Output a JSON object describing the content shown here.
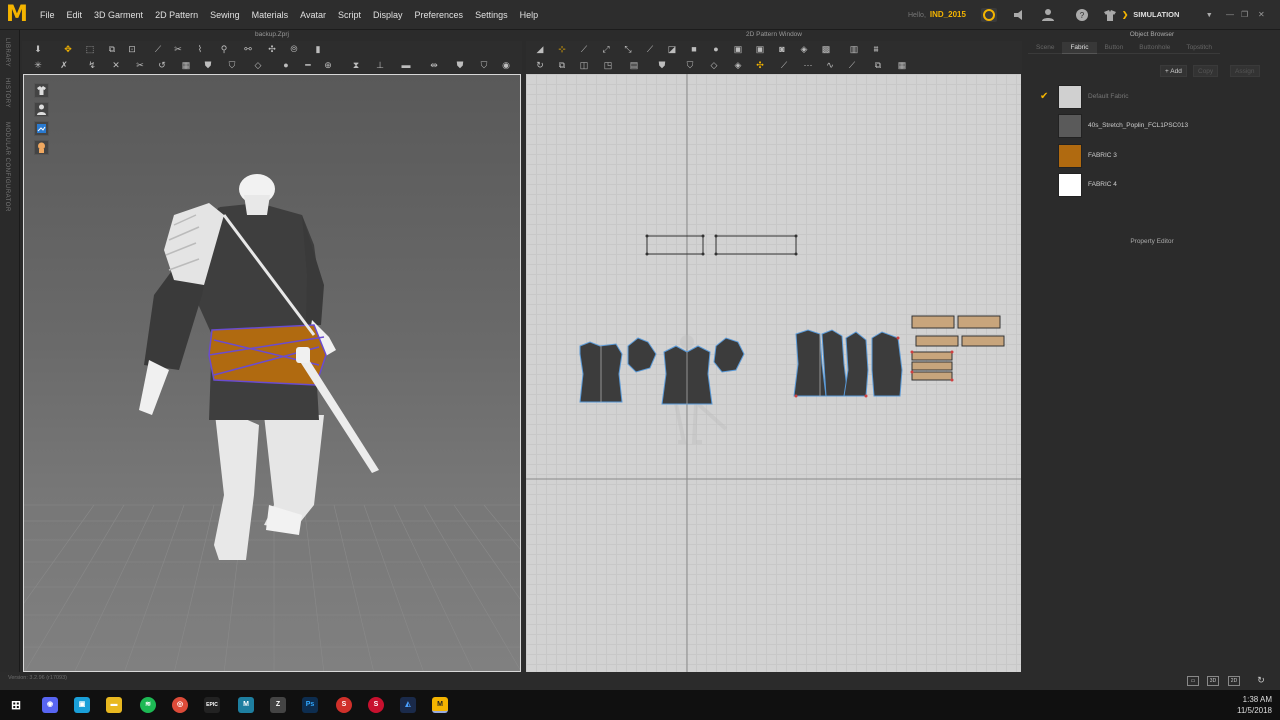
{
  "menubar": {
    "items": [
      "File",
      "Edit",
      "3D Garment",
      "2D Pattern",
      "Sewing",
      "Materials",
      "Avatar",
      "Script",
      "Display",
      "Preferences",
      "Settings",
      "Help"
    ],
    "user_prefix": "Hello,",
    "user_name": "IND_2015",
    "simulation_label": "SIMULATION"
  },
  "left_tabs": [
    "LIBRARY",
    "HISTORY",
    "MODULAR CONFIGURATOR"
  ],
  "window_3d": {
    "title": "backup.Zprj"
  },
  "window_2d": {
    "title": "2D Pattern Window"
  },
  "object_browser": {
    "title": "Object Browser",
    "tabs": [
      "Scene",
      "Fabric",
      "Button",
      "Buttonhole",
      "Topstitch"
    ],
    "active_tab": "Fabric",
    "buttons": {
      "add": "+ Add",
      "copy": "Copy",
      "assign": "Assign"
    },
    "fabrics": [
      {
        "name": "Default Fabric",
        "color": "#d0d0d0",
        "checked": true
      },
      {
        "name": "40s_Stretch_Poplin_FCL1PSC013",
        "color": "#5a5a5a",
        "checked": false
      },
      {
        "name": "FABRIC 3",
        "color": "#b06a10",
        "checked": false
      },
      {
        "name": "FABRIC 4",
        "color": "#ffffff",
        "checked": false
      }
    ]
  },
  "property_editor": {
    "title": "Property Editor"
  },
  "status": {
    "version": "Version: 3.2.96    (r17093)"
  },
  "taskbar": {
    "time": "1:38 AM",
    "date": "11/5/2018",
    "apps": [
      "windows-start",
      "discord",
      "app-blue",
      "file-explorer",
      "spotify",
      "chrome",
      "epic-games",
      "marvelous-designer",
      "zbrush",
      "photoshop",
      "app-red",
      "app-red-2",
      "app-blue-dark",
      "marvelous-designer-active"
    ]
  },
  "colors": {
    "accent": "#f4b400",
    "fabric_orange": "#b06a10",
    "grid_bg": "#d2d2d2"
  }
}
